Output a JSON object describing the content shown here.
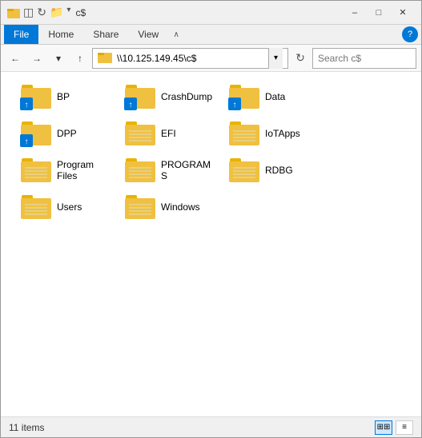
{
  "titleBar": {
    "title": "c$",
    "minimizeLabel": "–",
    "maximizeLabel": "□",
    "closeLabel": "✕"
  },
  "ribbon": {
    "tabs": [
      "File",
      "Home",
      "Share",
      "View"
    ],
    "activeTab": "File",
    "chevronLabel": "∧",
    "helpLabel": "?"
  },
  "navBar": {
    "backLabel": "←",
    "forwardLabel": "→",
    "upLabel": "↑",
    "addressValue": "\\\\10.125.149.45\\c$",
    "dropdownLabel": "▾",
    "refreshLabel": "↻",
    "searchPlaceholder": "Search c$",
    "searchIconLabel": "🔍"
  },
  "folders": [
    {
      "name": "BP",
      "overlay": true
    },
    {
      "name": "CrashDump",
      "overlay": true
    },
    {
      "name": "Data",
      "overlay": true
    },
    {
      "name": "DPP",
      "overlay": true
    },
    {
      "name": "EFI",
      "overlay": false
    },
    {
      "name": "IoTApps",
      "overlay": false
    },
    {
      "name": "Program Files",
      "overlay": false
    },
    {
      "name": "PROGRAMS",
      "overlay": false
    },
    {
      "name": "RDBG",
      "overlay": false
    },
    {
      "name": "Users",
      "overlay": false
    },
    {
      "name": "Windows",
      "overlay": false
    }
  ],
  "statusBar": {
    "itemCount": "11 items",
    "viewGridLabel": "⊞",
    "viewListLabel": "≡"
  }
}
